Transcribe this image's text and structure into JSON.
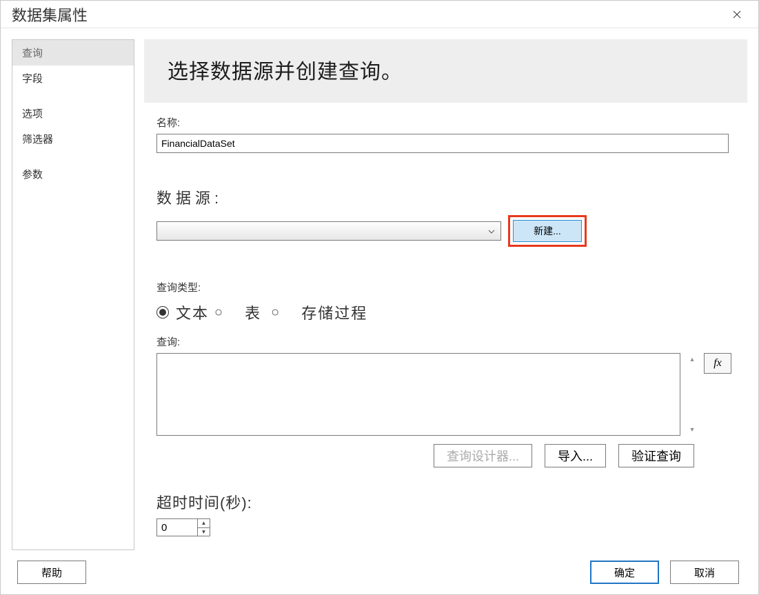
{
  "window": {
    "title": "数据集属性"
  },
  "sidebar": {
    "items": [
      {
        "label": "查询",
        "active": true
      },
      {
        "label": "字段",
        "active": false
      },
      {
        "label": "选项",
        "active": false
      },
      {
        "label": "筛选器",
        "active": false
      },
      {
        "label": "参数",
        "active": false
      }
    ]
  },
  "main": {
    "heading_pre": "选择",
    "heading_em": "数据源并创",
    "heading_post": "建查询。",
    "name_label": "名称:",
    "name_value": "FinancialDataSet",
    "datasource_label": "数据源:",
    "datasource_value": "",
    "new_button": "新建...",
    "query_type_label": "查询类型:",
    "radio_text": "文本",
    "radio_table": "表",
    "radio_proc": "存储过程",
    "query_label": "查询:",
    "query_value": "",
    "fx_label": "fx",
    "query_designer": "查询设计器...",
    "import": "导入...",
    "validate": "验证查询",
    "timeout_label": "超时时间(秒):",
    "timeout_value": "0"
  },
  "footer": {
    "help": "帮助",
    "ok": "确定",
    "cancel": "取消"
  }
}
